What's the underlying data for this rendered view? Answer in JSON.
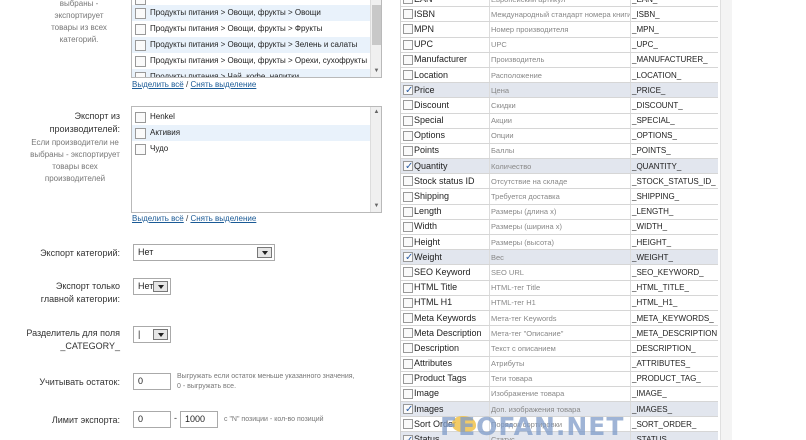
{
  "categories": {
    "help_lines": [
      "выбраны - экспортирует",
      "товары из всех категорий."
    ],
    "items": [
      "Продукты питания > Овощи, фрукты > Овощи",
      "Продукты питания > Овощи, фрукты > Фрукты",
      "Продукты питания > Овощи, фрукты > Зелень и салаты",
      "Продукты питания > Овощи, фрукты > Орехи, сухофрукты",
      "Продукты питания > Чай, кофе, напитки"
    ],
    "select_all": "Выделить всё",
    "separator": "/",
    "deselect": "Снять выделение"
  },
  "manufacturers": {
    "label_lines": [
      "Экспорт из",
      "производителей:"
    ],
    "help_lines": [
      "Если производители не",
      "выбраны - экспортирует",
      "товары всех",
      "производителей"
    ],
    "items": [
      "Henkel",
      "Активия",
      "Чудо"
    ],
    "select_all": "Выделить всё",
    "separator": "/",
    "deselect": "Снять выделение"
  },
  "export_categories": {
    "label": "Экспорт категорий:",
    "value": "Нет"
  },
  "main_category": {
    "label_lines": [
      "Экспорт только",
      "главной категории:"
    ],
    "value": "Нет"
  },
  "category_separator": {
    "label_lines": [
      "Разделитель для поля",
      "_CATEGORY_"
    ],
    "value": "|"
  },
  "stock": {
    "label": "Учитывать остаток:",
    "value": "0",
    "help_lines": [
      "Выгружать если остаток меньше указанного значения,",
      "0 - выгружать все."
    ]
  },
  "limit": {
    "label": "Лимит экспорта:",
    "from": "0",
    "dash": "-",
    "to": "1000",
    "help": "с \"N\" позиции - кол-во позиций"
  },
  "fields": [
    {
      "name": "EAN",
      "desc": "Европейский артикул",
      "tag": "_EAN_",
      "checked": false
    },
    {
      "name": "ISBN",
      "desc": "Международный стандарт номера книги",
      "tag": "_ISBN_",
      "checked": false
    },
    {
      "name": "MPN",
      "desc": "Номер производителя",
      "tag": "_MPN_",
      "checked": false
    },
    {
      "name": "UPC",
      "desc": "UPC",
      "tag": "_UPC_",
      "checked": false
    },
    {
      "name": "Manufacturer",
      "desc": "Производитель",
      "tag": "_MANUFACTURER_",
      "checked": false
    },
    {
      "name": "Location",
      "desc": "Расположение",
      "tag": "_LOCATION_",
      "checked": false
    },
    {
      "name": "Price",
      "desc": "Цена",
      "tag": "_PRICE_",
      "checked": true
    },
    {
      "name": "Discount",
      "desc": "Скидки",
      "tag": "_DISCOUNT_",
      "checked": false
    },
    {
      "name": "Special",
      "desc": "Акции",
      "tag": "_SPECIAL_",
      "checked": false
    },
    {
      "name": "Options",
      "desc": "Опции",
      "tag": "_OPTIONS_",
      "checked": false
    },
    {
      "name": "Points",
      "desc": "Баллы",
      "tag": "_POINTS_",
      "checked": false
    },
    {
      "name": "Quantity",
      "desc": "Количество",
      "tag": "_QUANTITY_",
      "checked": true
    },
    {
      "name": "Stock status ID",
      "desc": "Отсутствие на складе",
      "tag": "_STOCK_STATUS_ID_",
      "checked": false
    },
    {
      "name": "Shipping",
      "desc": "Требуется доставка",
      "tag": "_SHIPPING_",
      "checked": false
    },
    {
      "name": "Length",
      "desc": "Размеры (длина x)",
      "tag": "_LENGTH_",
      "checked": false
    },
    {
      "name": "Width",
      "desc": "Размеры (ширина x)",
      "tag": "_WIDTH_",
      "checked": false
    },
    {
      "name": "Height",
      "desc": "Размеры (высота)",
      "tag": "_HEIGHT_",
      "checked": false
    },
    {
      "name": "Weight",
      "desc": "Вес",
      "tag": "_WEIGHT_",
      "checked": true
    },
    {
      "name": "SEO Keyword",
      "desc": "SEO URL",
      "tag": "_SEO_KEYWORD_",
      "checked": false
    },
    {
      "name": "HTML Title",
      "desc": "HTML-тег Title",
      "tag": "_HTML_TITLE_",
      "checked": false
    },
    {
      "name": "HTML H1",
      "desc": "HTML-тег H1",
      "tag": "_HTML_H1_",
      "checked": false
    },
    {
      "name": "Meta Keywords",
      "desc": "Мета-тег Keywords",
      "tag": "_META_KEYWORDS_",
      "checked": false
    },
    {
      "name": "Meta Description",
      "desc": "Мета-тег \"Описание\"",
      "tag": "_META_DESCRIPTION_",
      "checked": false
    },
    {
      "name": "Description",
      "desc": "Текст с описанием",
      "tag": "_DESCRIPTION_",
      "checked": false
    },
    {
      "name": "Attributes",
      "desc": "Атрибуты",
      "tag": "_ATTRIBUTES_",
      "checked": false
    },
    {
      "name": "Product Tags",
      "desc": "Теги товара",
      "tag": "_PRODUCT_TAG_",
      "checked": false
    },
    {
      "name": "Image",
      "desc": "Изображение товара",
      "tag": "_IMAGE_",
      "checked": false
    },
    {
      "name": "Images",
      "desc": "Доп. изображения товара",
      "tag": "_IMAGES_",
      "checked": true
    },
    {
      "name": "Sort Order",
      "desc": "Порядок сортировки",
      "tag": "_SORT_ORDER_",
      "checked": false
    },
    {
      "name": "Status",
      "desc": "Статус",
      "tag": "_STATUS_",
      "checked": true
    }
  ],
  "watermark": "FEOFAN.NET"
}
